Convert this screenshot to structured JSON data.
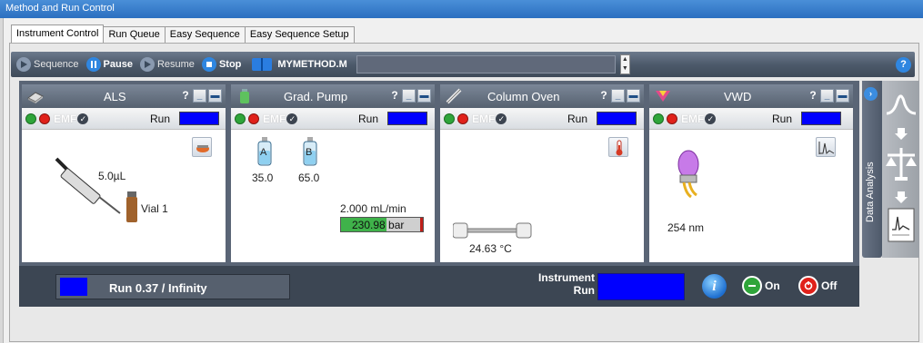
{
  "window": {
    "title": "Method and Run Control"
  },
  "tabs": [
    {
      "label": "Instrument Control",
      "active": true
    },
    {
      "label": "Run Queue",
      "active": false
    },
    {
      "label": "Easy Sequence",
      "active": false
    },
    {
      "label": "Easy Sequence Setup",
      "active": false
    }
  ],
  "toolbar": {
    "sequence_label": "Sequence",
    "pause_label": "Pause",
    "resume_label": "Resume",
    "stop_label": "Stop",
    "method_name": "MYMETHOD.M",
    "help_label": "?"
  },
  "modules": {
    "als": {
      "title": "ALS",
      "help": "?",
      "emf": "EMF",
      "run_label": "Run",
      "volume": "5.0µL",
      "vial": "Vial 1"
    },
    "pump": {
      "title": "Grad. Pump",
      "help": "?",
      "emf": "EMF",
      "run_label": "Run",
      "bottle_a_label": "A",
      "bottle_b_label": "B",
      "bottle_a_value": "35.0",
      "bottle_b_value": "65.0",
      "flow": "2.000 mL/min",
      "pressure": "230.98 bar",
      "pressure_fill": 0.55
    },
    "oven": {
      "title": "Column Oven",
      "help": "?",
      "emf": "EMF",
      "run_label": "Run",
      "temperature": "24.63 °C"
    },
    "vwd": {
      "title": "VWD",
      "help": "?",
      "emf": "EMF",
      "run_label": "Run",
      "wavelength": "254 nm"
    }
  },
  "status_bar": {
    "run_text": "Run 0.37 / Infinity",
    "instrument_label_line1": "Instrument",
    "instrument_label_line2": "Run",
    "info_label": "i",
    "on_label": "On",
    "off_label": "Off"
  },
  "data_analysis": {
    "label": "Data Analysis"
  },
  "colors": {
    "run_indicator": "#0000ff",
    "on_green": "#2fa53a",
    "off_red": "#e0211a"
  }
}
